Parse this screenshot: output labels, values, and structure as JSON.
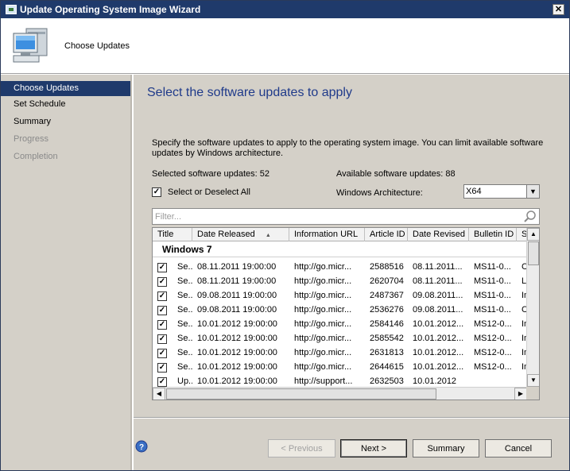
{
  "window": {
    "title": "Update Operating System Image Wizard",
    "close_glyph": "✕"
  },
  "header": {
    "title": "Choose Updates",
    "icon": "computer-monitor-icon"
  },
  "sidebar": {
    "items": [
      {
        "label": "Choose Updates",
        "state": "active"
      },
      {
        "label": "Set Schedule",
        "state": "normal"
      },
      {
        "label": "Summary",
        "state": "normal"
      },
      {
        "label": "Progress",
        "state": "disabled"
      },
      {
        "label": "Completion",
        "state": "disabled"
      }
    ]
  },
  "main": {
    "heading": "Select the software updates to apply",
    "description": "Specify the software updates to apply to the operating system image. You can limit available software updates by Windows architecture.",
    "selected_updates": "Selected software updates: 52",
    "available_updates": "Available software updates: 88",
    "select_all_label": "Select or Deselect All",
    "select_all_checked": true,
    "arch_label": "Windows Architecture:",
    "arch_value": "X64",
    "filter_placeholder": "Filter..."
  },
  "grid": {
    "columns": [
      "Title",
      "Date Released",
      "Information URL",
      "Article ID",
      "Date Revised",
      "Bulletin ID",
      "Se"
    ],
    "sort_indicator": "▲",
    "group_label": "Windows 7",
    "rows": [
      {
        "checked": true,
        "title": "Se...",
        "released": "08.11.2011 19:00:00",
        "url": "http://go.micr...",
        "article": "2588516",
        "revised": "08.11.2011...",
        "bulletin": "MS11-0...",
        "sev": "Cr"
      },
      {
        "checked": true,
        "title": "Se...",
        "released": "08.11.2011 19:00:00",
        "url": "http://go.micr...",
        "article": "2620704",
        "revised": "08.11.2011...",
        "bulletin": "MS11-0...",
        "sev": "Lo"
      },
      {
        "checked": true,
        "title": "Se...",
        "released": "09.08.2011 19:00:00",
        "url": "http://go.micr...",
        "article": "2487367",
        "revised": "09.08.2011...",
        "bulletin": "MS11-0...",
        "sev": "Im"
      },
      {
        "checked": true,
        "title": "Se...",
        "released": "09.08.2011 19:00:00",
        "url": "http://go.micr...",
        "article": "2536276",
        "revised": "09.08.2011...",
        "bulletin": "MS11-0...",
        "sev": "Cr"
      },
      {
        "checked": true,
        "title": "Se...",
        "released": "10.01.2012 19:00:00",
        "url": "http://go.micr...",
        "article": "2584146",
        "revised": "10.01.2012...",
        "bulletin": "MS12-0...",
        "sev": "Im"
      },
      {
        "checked": true,
        "title": "Se...",
        "released": "10.01.2012 19:00:00",
        "url": "http://go.micr...",
        "article": "2585542",
        "revised": "10.01.2012...",
        "bulletin": "MS12-0...",
        "sev": "Im"
      },
      {
        "checked": true,
        "title": "Se...",
        "released": "10.01.2012 19:00:00",
        "url": "http://go.micr...",
        "article": "2631813",
        "revised": "10.01.2012...",
        "bulletin": "MS12-0...",
        "sev": "Im"
      },
      {
        "checked": true,
        "title": "Se...",
        "released": "10.01.2012 19:00:00",
        "url": "http://go.micr...",
        "article": "2644615",
        "revised": "10.01.2012...",
        "bulletin": "MS12-0...",
        "sev": "Im"
      },
      {
        "checked": true,
        "title": "Up...",
        "released": "10.01.2012 19:00:00",
        "url": "http://support...",
        "article": "2632503",
        "revised": "10.01.2012",
        "bulletin": "",
        "sev": ""
      }
    ]
  },
  "buttons": {
    "previous": "< Previous",
    "next": "Next >",
    "summary": "Summary",
    "cancel": "Cancel"
  },
  "help_glyph": "?"
}
